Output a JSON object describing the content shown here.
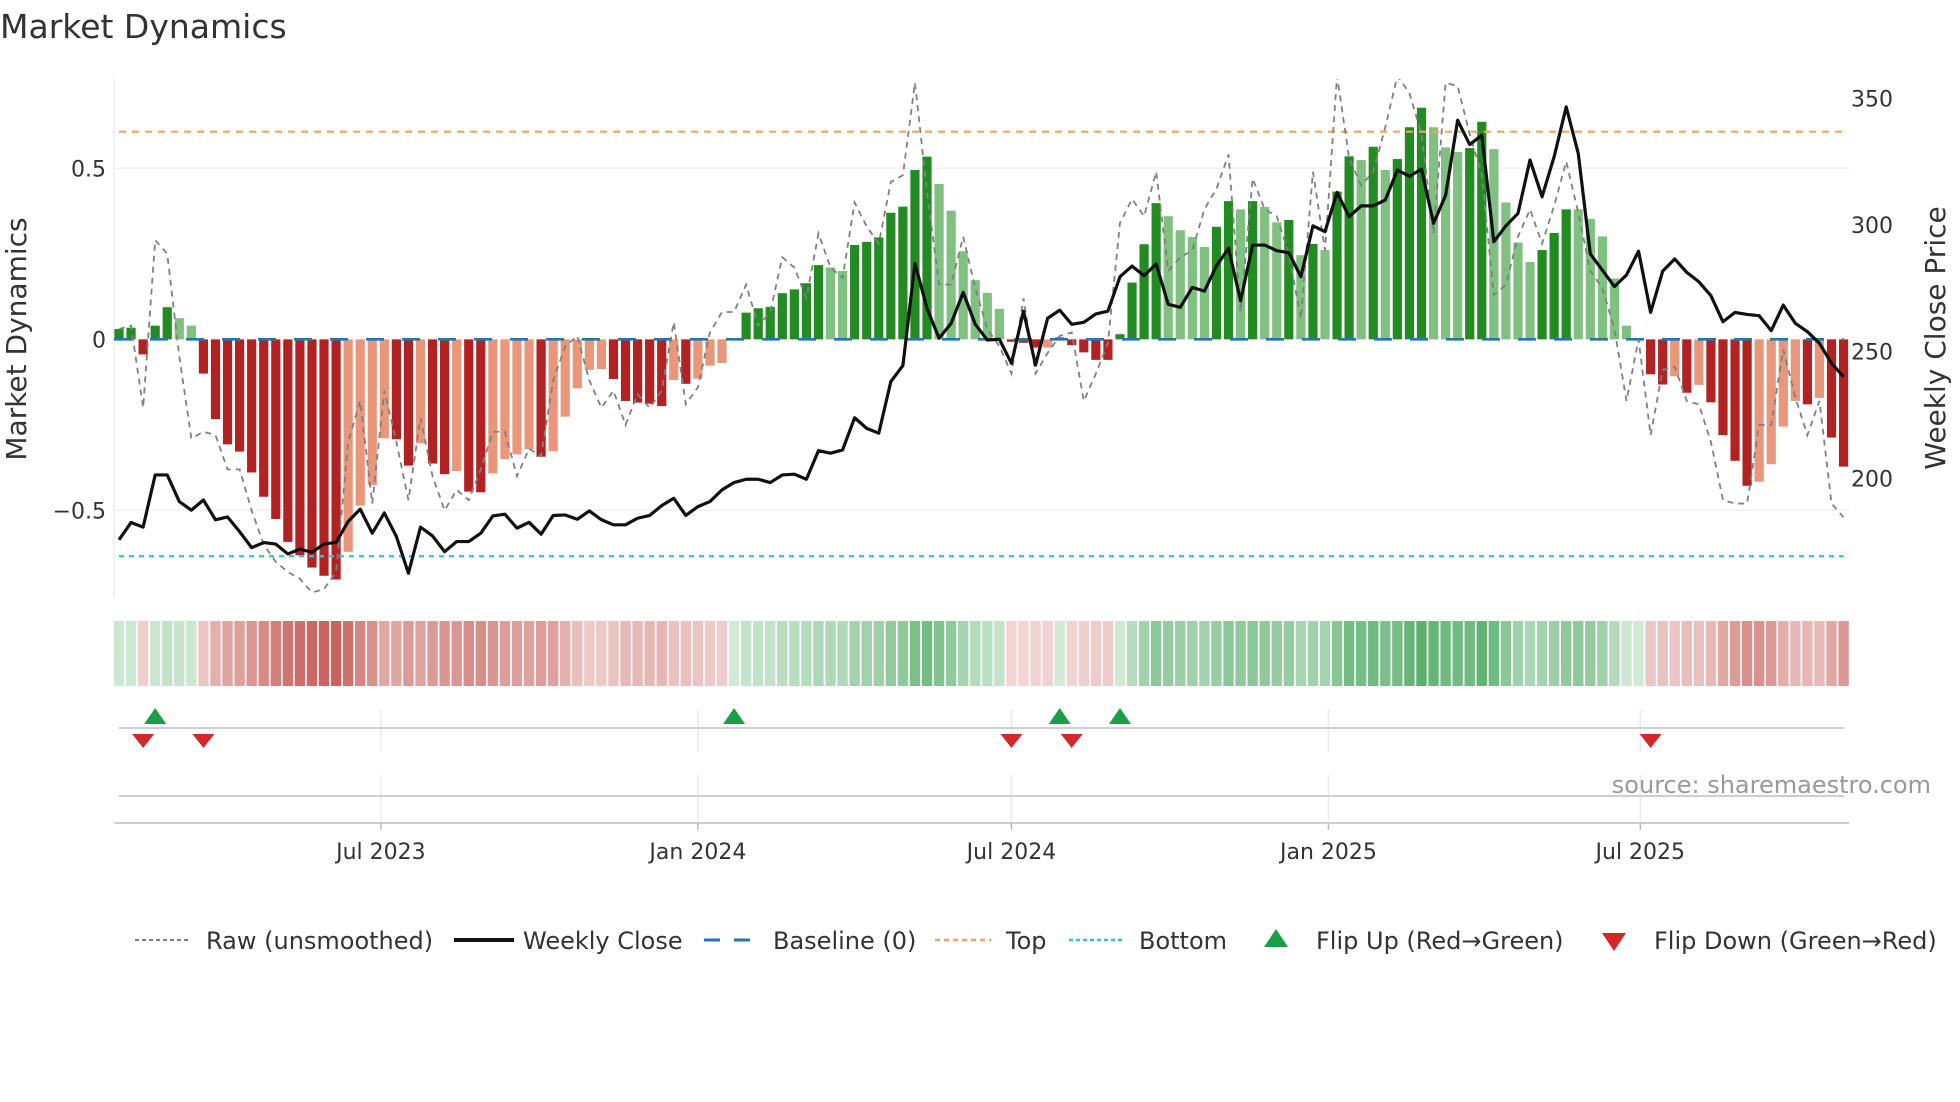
{
  "title": "Market Dynamics",
  "source": "source: sharemaestro.com",
  "colors": {
    "dark_green": "#228b22",
    "light_green": "#80c080",
    "red": "#b22222",
    "salmon": "#e9967a",
    "close": "#111111",
    "raw": "#808080",
    "baseline": "#1f77b4",
    "top": "#f4a460",
    "bottom": "#2ec4d6",
    "flip_up": "#1a9e48",
    "flip_down": "#d62728"
  },
  "legend": [
    {
      "key": "raw",
      "label": "Raw (unsmoothed)"
    },
    {
      "key": "close",
      "label": "Weekly Close"
    },
    {
      "key": "baseline",
      "label": "Baseline (0)"
    },
    {
      "key": "top",
      "label": "Top"
    },
    {
      "key": "bottom",
      "label": "Bottom"
    },
    {
      "key": "flip_up",
      "label": "Flip Up (Red→Green)"
    },
    {
      "key": "flip_down",
      "label": "Flip Down (Green→Red)"
    }
  ],
  "chart_data": {
    "type": "bar",
    "title": "Market Dynamics",
    "ylabel": "Market Dynamics",
    "ylabel_right": "Weekly Close Price",
    "ylim": [
      -0.756,
      0.761
    ],
    "ylim_right": [
      152.7,
      357.7
    ],
    "left_ticks": [
      {
        "value": 0.5,
        "label": "0.5"
      },
      {
        "value": 0,
        "label": "0"
      },
      {
        "value": -0.5,
        "label": "−0.5"
      }
    ],
    "right_ticks": [
      {
        "value": 350,
        "label": "350"
      },
      {
        "value": 300,
        "label": "300"
      },
      {
        "value": 250,
        "label": "250"
      },
      {
        "value": 200,
        "label": "200"
      }
    ],
    "x_ticks": [
      {
        "date": "2023-07-01",
        "label": "Jul 2023"
      },
      {
        "date": "2024-01-01",
        "label": "Jan 2024"
      },
      {
        "date": "2024-07-01",
        "label": "Jul 2024"
      },
      {
        "date": "2025-01-01",
        "label": "Jan 2025"
      },
      {
        "date": "2025-07-01",
        "label": "Jul 2025"
      }
    ],
    "start_date": "2023-01-30",
    "interval_days": 7,
    "baseline": 0,
    "top_level": 0.607,
    "bottom_level": -0.634,
    "bar_shade_key": {
      "G": "dark_green",
      "g": "light_green",
      "R": "red",
      "r": "salmon"
    },
    "bar_shade": "GGRGGggRRRRRRRRRRRRrrrrRRrRRrRRrrrrRrrrrrRRRRRrRrrrGGGGGGGGggGGGGGGGggggggRRRrGRRRRGGGGggggGGgGggGgGgGGgGgGGGgggGGggggGGGggggggRRrRrRRRRrrrrRrRR",
    "momentum": [
      0.03,
      0.034,
      -0.044,
      0.04,
      0.094,
      0.062,
      0.04,
      -0.1,
      -0.233,
      -0.307,
      -0.328,
      -0.389,
      -0.46,
      -0.525,
      -0.592,
      -0.631,
      -0.667,
      -0.691,
      -0.702,
      -0.621,
      -0.486,
      -0.426,
      -0.289,
      -0.292,
      -0.369,
      -0.304,
      -0.363,
      -0.394,
      -0.385,
      -0.445,
      -0.447,
      -0.392,
      -0.35,
      -0.336,
      -0.321,
      -0.343,
      -0.327,
      -0.226,
      -0.143,
      -0.089,
      -0.087,
      -0.116,
      -0.18,
      -0.185,
      -0.188,
      -0.195,
      -0.119,
      -0.13,
      -0.115,
      -0.077,
      -0.069,
      0.004,
      0.078,
      0.091,
      0.095,
      0.135,
      0.146,
      0.164,
      0.217,
      0.21,
      0.2,
      0.276,
      0.285,
      0.298,
      0.37,
      0.388,
      0.495,
      0.534,
      0.454,
      0.376,
      0.258,
      0.173,
      0.136,
      0.089,
      -0.007,
      -0.01,
      -0.024,
      -0.024,
      0.006,
      -0.017,
      -0.038,
      -0.06,
      -0.06,
      0.015,
      0.166,
      0.278,
      0.398,
      0.36,
      0.319,
      0.299,
      0.27,
      0.329,
      0.404,
      0.38,
      0.404,
      0.387,
      0.342,
      0.349,
      0.246,
      0.279,
      0.261,
      0.432,
      0.535,
      0.524,
      0.563,
      0.495,
      0.527,
      0.62,
      0.677,
      0.62,
      0.561,
      0.548,
      0.559,
      0.636,
      0.556,
      0.4,
      0.283,
      0.226,
      0.261,
      0.311,
      0.38,
      0.38,
      0.352,
      0.301,
      0.178,
      0.04,
      0.003,
      -0.102,
      -0.132,
      -0.108,
      -0.156,
      -0.133,
      -0.184,
      -0.28,
      -0.355,
      -0.428,
      -0.416,
      -0.365,
      -0.255,
      -0.18,
      -0.19,
      -0.171,
      -0.287,
      -0.372
    ],
    "raw": [
      0.03,
      0.04,
      -0.2,
      0.29,
      0.25,
      -0.05,
      -0.29,
      -0.27,
      -0.28,
      -0.38,
      -0.38,
      -0.5,
      -0.6,
      -0.65,
      -0.68,
      -0.7,
      -0.74,
      -0.73,
      -0.68,
      -0.3,
      -0.18,
      -0.48,
      -0.15,
      -0.3,
      -0.47,
      -0.23,
      -0.4,
      -0.5,
      -0.44,
      -0.47,
      -0.38,
      -0.27,
      -0.27,
      -0.4,
      -0.32,
      -0.34,
      -0.12,
      -0.02,
      0.01,
      -0.12,
      -0.2,
      -0.15,
      -0.25,
      -0.16,
      -0.2,
      -0.15,
      0.05,
      -0.19,
      -0.14,
      0.02,
      0.08,
      0.08,
      0.16,
      0.04,
      0.08,
      0.24,
      0.21,
      0.12,
      0.31,
      0.21,
      0.18,
      0.4,
      0.33,
      0.28,
      0.46,
      0.48,
      0.75,
      0.43,
      0.16,
      0.16,
      0.3,
      0.15,
      0.03,
      -0.02,
      -0.1,
      0.12,
      -0.1,
      -0.04,
      0.01,
      0.02,
      -0.18,
      -0.1,
      -0.01,
      0.34,
      0.41,
      0.36,
      0.49,
      0.2,
      0.24,
      0.26,
      0.38,
      0.44,
      0.54,
      0.08,
      0.47,
      0.38,
      0.36,
      0.25,
      0.06,
      0.49,
      0.26,
      0.77,
      0.53,
      0.45,
      0.49,
      0.62,
      0.77,
      0.72,
      0.6,
      0.31,
      0.75,
      0.74,
      0.6,
      0.48,
      0.13,
      0.16,
      0.3,
      0.38,
      0.28,
      0.39,
      0.52,
      0.37,
      0.2,
      0.15,
      0.03,
      -0.18,
      0.0,
      -0.28,
      -0.09,
      -0.08,
      -0.18,
      -0.19,
      -0.3,
      -0.47,
      -0.48,
      -0.48,
      -0.25,
      -0.25,
      -0.03,
      -0.17,
      -0.28,
      -0.18,
      -0.48,
      -0.52
    ],
    "close": [
      175.7,
      182.5,
      180.7,
      201.3,
      201.3,
      190.8,
      187.4,
      191.4,
      183.6,
      184.7,
      178.9,
      172.6,
      174.6,
      174,
      170.1,
      172,
      170.8,
      174,
      174.7,
      182.9,
      187.8,
      178.3,
      186.3,
      177,
      162.5,
      180.7,
      177.2,
      171,
      175,
      175,
      178.3,
      185.1,
      185.8,
      180.3,
      182.6,
      177.9,
      185.3,
      185.5,
      183.8,
      187.1,
      183.6,
      181.6,
      181.6,
      184.2,
      185.3,
      189.2,
      192.1,
      185.3,
      188.8,
      190.8,
      195.4,
      198.3,
      199.6,
      199.6,
      198.3,
      201.3,
      201.6,
      199.6,
      210.9,
      209.9,
      211.2,
      223.9,
      219.7,
      217.8,
      238.2,
      244.5,
      284.9,
      267.1,
      255.3,
      261.2,
      273.4,
      260.8,
      254.6,
      254.9,
      245.4,
      266,
      244.7,
      263.2,
      266.4,
      260.8,
      261.6,
      264.9,
      266,
      279.6,
      283.8,
      280,
      284.6,
      268.7,
      267.5,
      275.4,
      273.9,
      283.9,
      290.8,
      270.1,
      292.1,
      292.1,
      289.9,
      289.1,
      279.6,
      299.7,
      297.4,
      312.9,
      303.3,
      307.6,
      307.6,
      309.9,
      321.7,
      319.3,
      322.1,
      300.7,
      311.8,
      341.4,
      331.8,
      335.5,
      293.4,
      299.7,
      304.6,
      325.7,
      311.2,
      327,
      346.7,
      328.3,
      288.6,
      282.2,
      275.7,
      280.3,
      289.7,
      265.5,
      281.8,
      286.6,
      281.3,
      277.6,
      272.1,
      261.8,
      265.5,
      264.7,
      264.2,
      258.3,
      268.4,
      261.2,
      257.9,
      253.3,
      245.4,
      240.1
    ],
    "flips_up": [
      "2023-02-20",
      "2024-01-22",
      "2024-07-29",
      "2024-09-02"
    ],
    "flips_down": [
      "2023-02-13",
      "2023-03-20",
      "2024-07-01",
      "2024-08-05",
      "2025-07-07"
    ]
  }
}
